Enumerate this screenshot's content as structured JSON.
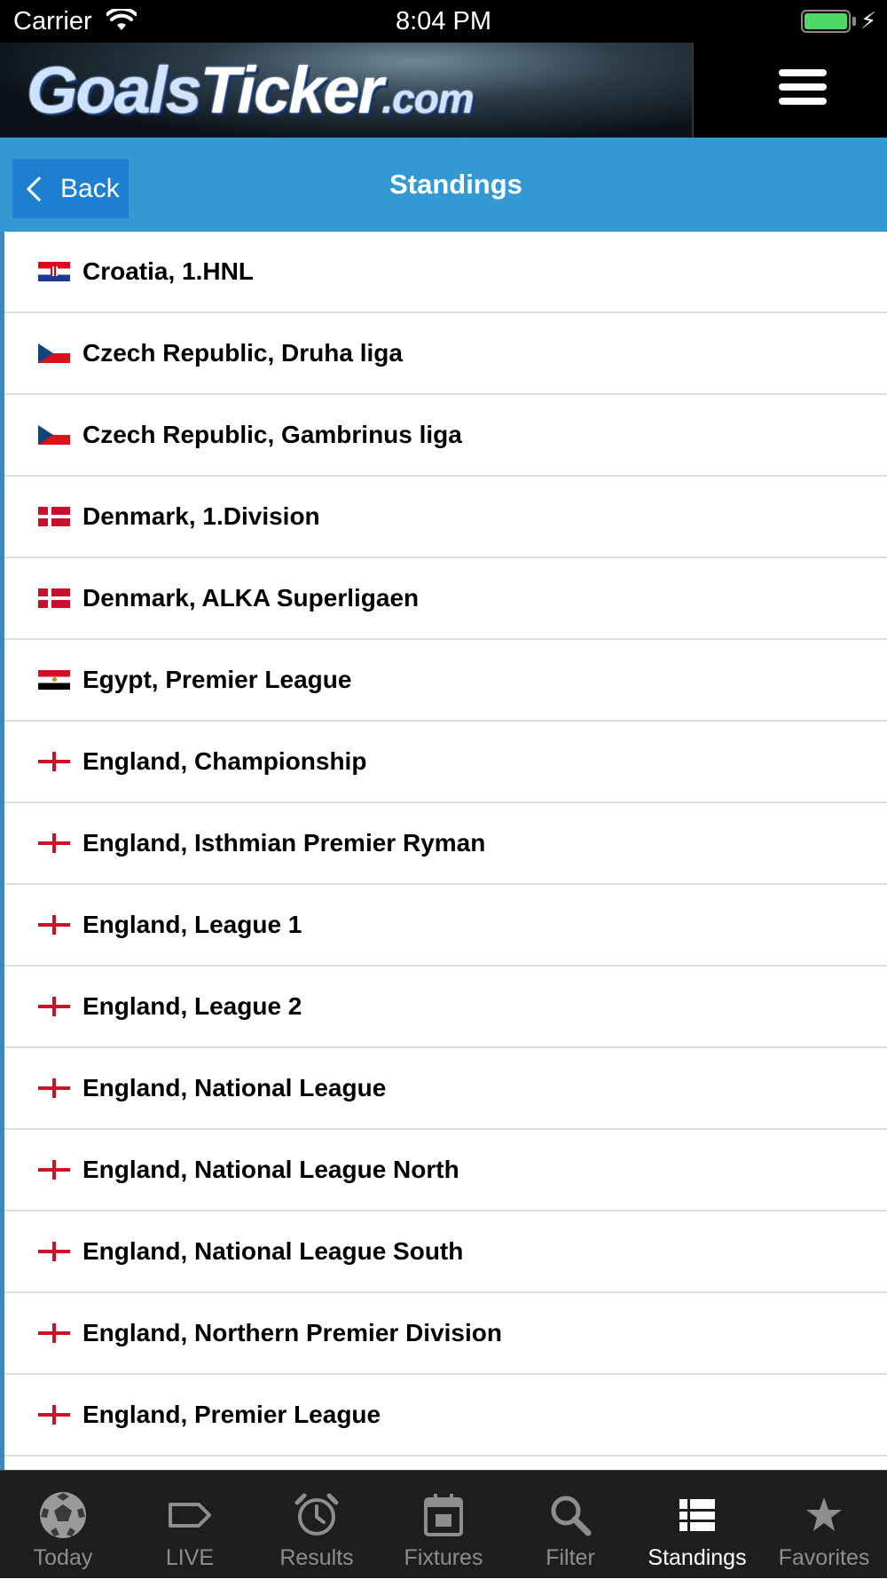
{
  "status_bar": {
    "carrier": "Carrier",
    "time": "8:04 PM"
  },
  "header": {
    "logo_text_1": "Goals",
    "logo_text_2": "Ticker",
    "logo_text_3": ".com",
    "menu_icon": "hamburger-menu-icon"
  },
  "titlebar": {
    "back_label": "Back",
    "title": "Standings"
  },
  "leagues": [
    {
      "label": "Croatia, 1.HNL",
      "flag": "hr"
    },
    {
      "label": "Czech Republic, Druha liga",
      "flag": "cz"
    },
    {
      "label": "Czech Republic, Gambrinus liga",
      "flag": "cz"
    },
    {
      "label": "Denmark, 1.Division",
      "flag": "dk"
    },
    {
      "label": "Denmark, ALKA Superligaen",
      "flag": "dk"
    },
    {
      "label": "Egypt, Premier League",
      "flag": "eg"
    },
    {
      "label": "England, Championship",
      "flag": "en"
    },
    {
      "label": "England, Isthmian Premier Ryman",
      "flag": "en"
    },
    {
      "label": "England, League 1",
      "flag": "en"
    },
    {
      "label": "England, League 2",
      "flag": "en"
    },
    {
      "label": "England, National League",
      "flag": "en"
    },
    {
      "label": "England, National League North",
      "flag": "en"
    },
    {
      "label": "England, National League South",
      "flag": "en"
    },
    {
      "label": "England, Northern Premier Division",
      "flag": "en"
    },
    {
      "label": "England, Premier League",
      "flag": "en"
    }
  ],
  "tabs": [
    {
      "label": "Today",
      "icon": "soccer-ball-icon",
      "active": false
    },
    {
      "label": "LIVE",
      "icon": "tag-icon",
      "active": false
    },
    {
      "label": "Results",
      "icon": "alarm-clock-icon",
      "active": false
    },
    {
      "label": "Fixtures",
      "icon": "calendar-icon",
      "active": false
    },
    {
      "label": "Filter",
      "icon": "search-icon",
      "active": false
    },
    {
      "label": "Standings",
      "icon": "list-icon",
      "active": true
    },
    {
      "label": "Favorites",
      "icon": "star-icon",
      "active": false
    }
  ],
  "colors": {
    "titlebar_bg": "#3399d3",
    "back_button_bg": "#1d7fcf",
    "tabbar_bg": "#1e1e1e",
    "tab_active": "#ffffff",
    "tab_inactive": "#8e8e8e"
  }
}
